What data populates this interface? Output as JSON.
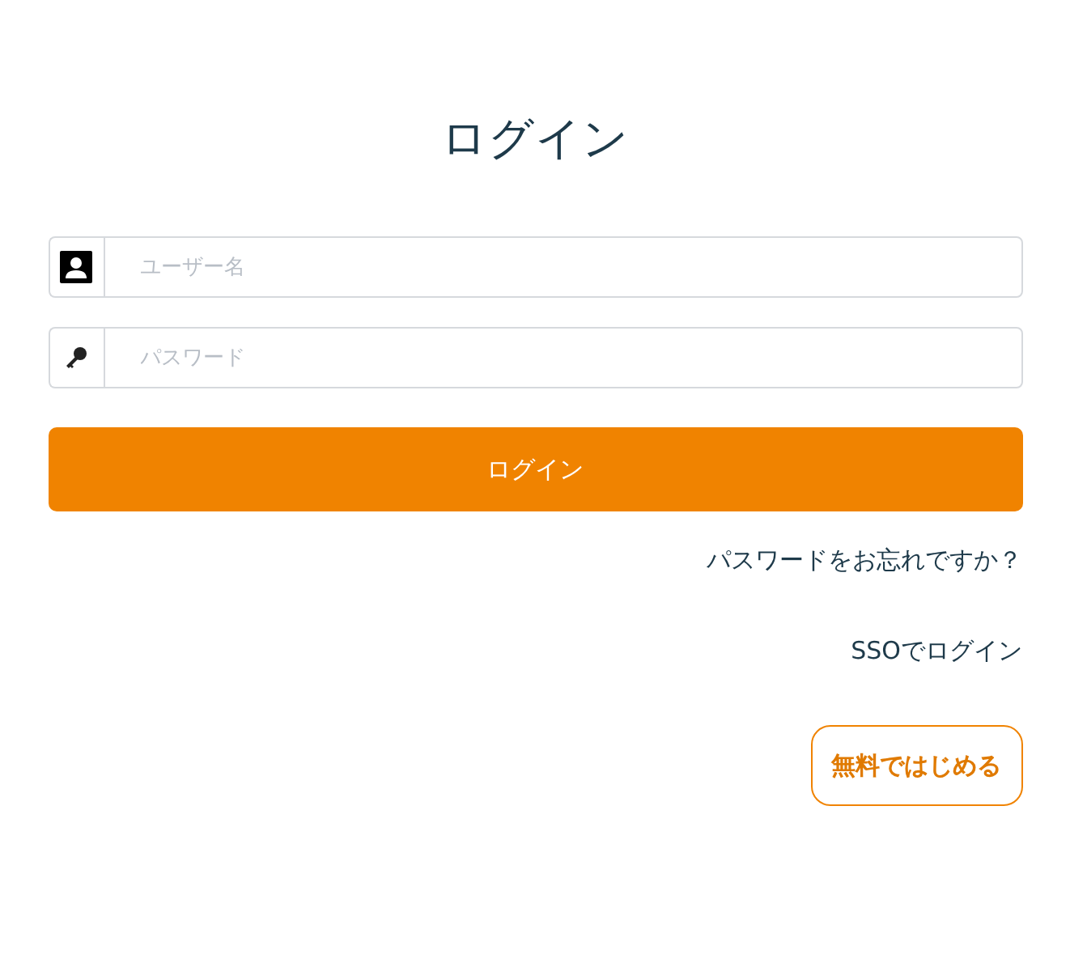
{
  "title": "ログイン",
  "fields": [
    {
      "kind": "user",
      "placeholder": "ユーザー名"
    },
    {
      "kind": "password",
      "placeholder": "パスワード"
    }
  ],
  "login_button": "ログイン",
  "forgot_link": "パスワードをお忘れですか？",
  "sso_link": "SSOでログイン",
  "signup_button": "無料ではじめる"
}
